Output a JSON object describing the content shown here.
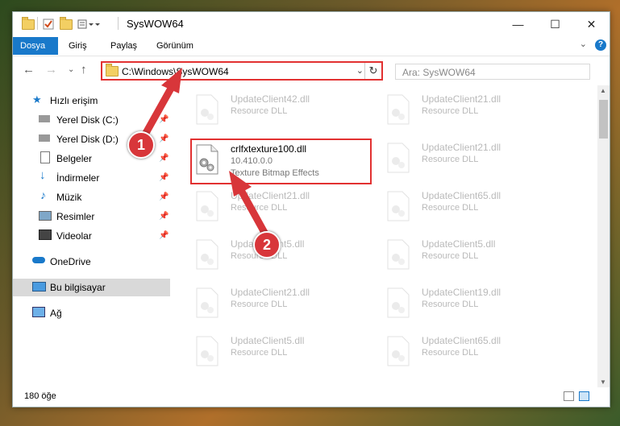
{
  "window": {
    "title": "SysWOW64",
    "controls": {
      "minimize": "—",
      "maximize": "☐",
      "close": "✕"
    }
  },
  "ribbon": {
    "tabs": [
      {
        "label": "Dosya",
        "active": true
      },
      {
        "label": "Giriş"
      },
      {
        "label": "Paylaş"
      },
      {
        "label": "Görünüm"
      }
    ],
    "help_label": "?"
  },
  "navigation": {
    "address": "C:\\Windows\\SysWOW64",
    "search_placeholder": "Ara: SysWOW64"
  },
  "sidebar": {
    "items": [
      {
        "label": "Hızlı erişim",
        "icon": "star-icon",
        "pinned": false
      },
      {
        "label": "Yerel Disk (C:)",
        "icon": "drive-icon",
        "pinned": true
      },
      {
        "label": "Yerel Disk (D:)",
        "icon": "drive-icon",
        "pinned": true
      },
      {
        "label": "Belgeler",
        "icon": "document-icon",
        "pinned": true
      },
      {
        "label": "İndirmeler",
        "icon": "download-icon",
        "pinned": true
      },
      {
        "label": "Müzik",
        "icon": "music-icon",
        "pinned": true
      },
      {
        "label": "Resimler",
        "icon": "pictures-icon",
        "pinned": true
      },
      {
        "label": "Videolar",
        "icon": "video-icon",
        "pinned": true
      },
      {
        "label": "OneDrive",
        "icon": "cloud-icon"
      },
      {
        "label": "Bu bilgisayar",
        "icon": "computer-icon",
        "selected": true
      },
      {
        "label": "Ağ",
        "icon": "network-icon"
      }
    ]
  },
  "files": {
    "highlighted": {
      "name": "crlfxtexture100.dll",
      "version": "10.410.0.0",
      "description": "Texture Bitmap Effects"
    },
    "left_column": [
      {
        "name": "UpdateClient42.dll",
        "type": "Resource DLL"
      },
      {
        "name": "UpdateClient21.dll",
        "type": "Resource DLL"
      },
      {
        "name": "UpdateClient5.dll",
        "type": "Resource DLL"
      },
      {
        "name": "UpdateClient21.dll",
        "type": "Resource DLL"
      },
      {
        "name": "UpdateClient5.dll",
        "type": "Resource DLL"
      }
    ],
    "right_column": [
      {
        "name": "UpdateClient21.dll",
        "type": "Resource DLL"
      },
      {
        "name": "UpdateClient21.dll",
        "type": "Resource DLL"
      },
      {
        "name": "UpdateClient65.dll",
        "type": "Resource DLL"
      },
      {
        "name": "UpdateClient5.dll",
        "type": "Resource DLL"
      },
      {
        "name": "UpdateClient19.dll",
        "type": "Resource DLL"
      },
      {
        "name": "UpdateClient65.dll",
        "type": "Resource DLL"
      }
    ]
  },
  "status": {
    "item_count": "180 öğe"
  },
  "callouts": {
    "first": "1",
    "second": "2"
  },
  "colors": {
    "accent": "#1979ca",
    "highlight": "#e23131",
    "callout": "#d8363a"
  }
}
